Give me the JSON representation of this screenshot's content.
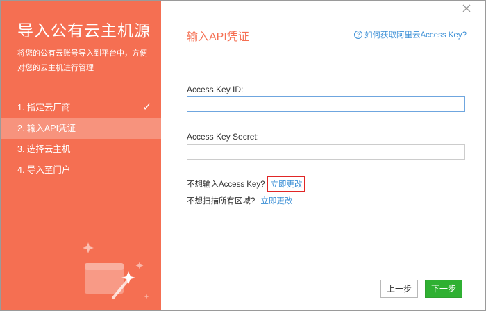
{
  "left_panel": {
    "title": "导入公有云主机源",
    "description": "将您的公有云账号导入到平台中，方便对您的云主机进行管理",
    "steps": [
      {
        "label": "1. 指定云厂商",
        "done": true
      },
      {
        "label": "2. 输入API凭证",
        "active": true
      },
      {
        "label": "3. 选择云主机"
      },
      {
        "label": "4. 导入至门户"
      }
    ],
    "illustration_icon": "magic-wand-card-icon"
  },
  "right_panel": {
    "title": "输入API凭证",
    "help_link": "如何获取阿里云Access Key?",
    "access_key_id": {
      "label": "Access Key ID:",
      "value": ""
    },
    "access_key_secret": {
      "label": "Access Key Secret:",
      "value": ""
    },
    "no_key": {
      "text": "不想输入Access Key?",
      "link": "立即更改"
    },
    "no_scan": {
      "text": "不想扫描所有区域?",
      "link": "立即更改"
    }
  },
  "buttons": {
    "prev": "上一步",
    "next": "下一步"
  },
  "colors": {
    "accent": "#f56f52",
    "link": "#3b8fd6",
    "primary_button": "#2fb032",
    "highlight_box": "#e02626"
  }
}
